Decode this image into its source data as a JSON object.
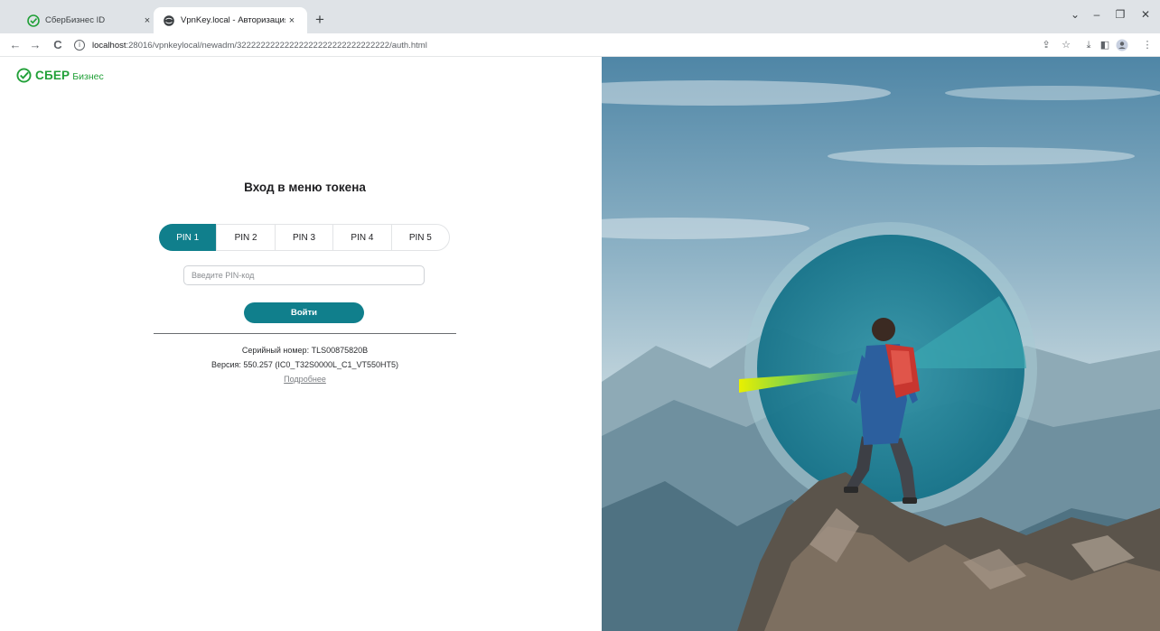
{
  "browser": {
    "tabs": [
      {
        "label": "СберБизнес ID",
        "active": false
      },
      {
        "label": "VpnKey.local - Авторизация",
        "active": true
      }
    ],
    "new_tab_symbol": "+",
    "close_symbol": "×",
    "window_controls": {
      "dropdown": "⌄",
      "minimize": "–",
      "restore": "❐",
      "close": "✕"
    },
    "url_host": "localhost",
    "url_rest": ":28016/vpnkeylocal/newadm/32222222222222222222222222222222/auth.html",
    "icons": [
      "back-icon",
      "forward-icon",
      "reload-icon",
      "site-info-icon",
      "share-icon",
      "bookmark-star-icon",
      "download-icon",
      "side-panel-icon",
      "profile-icon",
      "menu-icon"
    ]
  },
  "logo": {
    "brand": "СБЕР",
    "sub": "Бизнес",
    "color": "#21a038"
  },
  "login": {
    "title": "Вход в меню токена",
    "pin_tabs": [
      "PIN 1",
      "PIN 2",
      "PIN 3",
      "PIN 4",
      "PIN 5"
    ],
    "active_pin_tab": "PIN 1",
    "pin_placeholder": "Введите PIN-код",
    "pin_value": "",
    "submit_label": "Войти"
  },
  "device": {
    "serial": "Серийный номер: TLS00875820B",
    "version": "Версия: 550.257 (IC0_T32S0000L_C1_VT550HT5)",
    "more_link": "Подробнее"
  },
  "colors": {
    "accent": "#107f8c",
    "brand_green": "#21a038"
  }
}
